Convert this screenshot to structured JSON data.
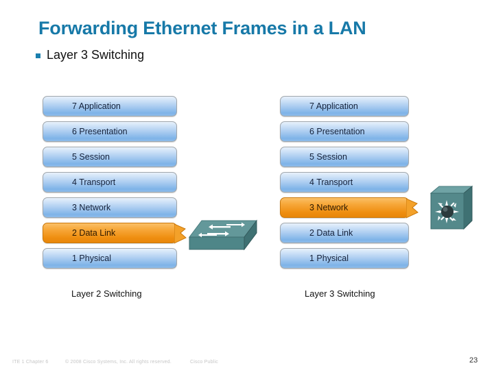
{
  "slide": {
    "title": "Forwarding Ethernet Frames in a LAN",
    "bullet": {
      "marker": "square-bullet",
      "text": "Layer 3 Switching"
    },
    "title_color": "#1779a8",
    "accent_color": "#1b7fae",
    "highlight_color": "#f0930f",
    "layer_color": "#a9cbf0"
  },
  "diagram": {
    "left_stack": {
      "caption": "Layer 2 Switching",
      "highlighted_layer": "2 Data Link",
      "layers": [
        {
          "label": "7 Application",
          "highlighted": false
        },
        {
          "label": "6 Presentation",
          "highlighted": false
        },
        {
          "label": "5 Session",
          "highlighted": false
        },
        {
          "label": "4 Transport",
          "highlighted": false
        },
        {
          "label": "3 Network",
          "highlighted": false
        },
        {
          "label": "2 Data Link",
          "highlighted": true
        },
        {
          "label": "1 Physical",
          "highlighted": false
        }
      ],
      "device_icon": "switch-icon"
    },
    "right_stack": {
      "caption": "Layer 3 Switching",
      "highlighted_layer": "3 Network",
      "layers": [
        {
          "label": "7 Application",
          "highlighted": false
        },
        {
          "label": "6 Presentation",
          "highlighted": false
        },
        {
          "label": "5 Session",
          "highlighted": false
        },
        {
          "label": "4 Transport",
          "highlighted": false
        },
        {
          "label": "3 Network",
          "highlighted": true
        },
        {
          "label": "2 Data Link",
          "highlighted": false
        },
        {
          "label": "1 Physical",
          "highlighted": false
        }
      ],
      "device_icon": "multilayer-switch-icon"
    }
  },
  "footer": {
    "chapter": "ITE 1 Chapter 6",
    "copyright": "© 2008 Cisco Systems, Inc. All rights reserved.",
    "classification": "Cisco Public",
    "page_number": "23"
  }
}
